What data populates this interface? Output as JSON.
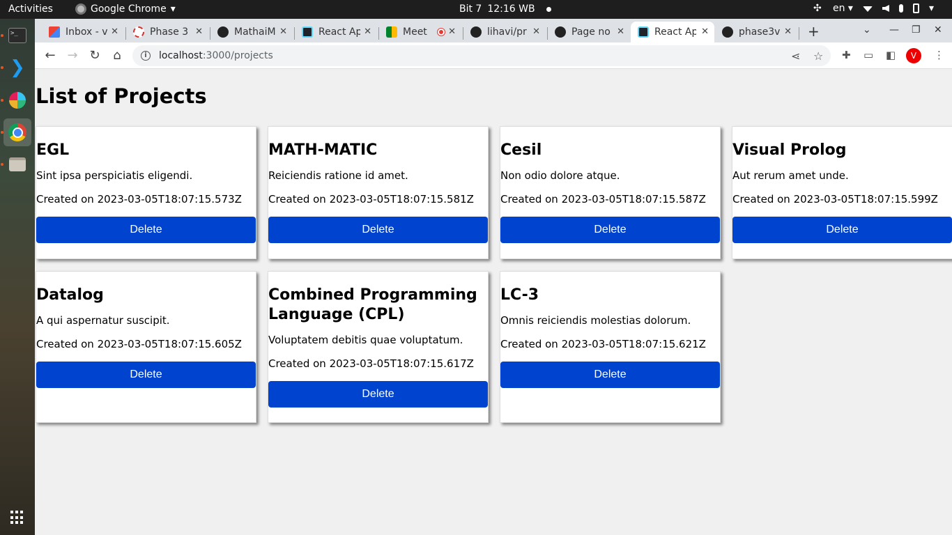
{
  "topbar": {
    "activities": "Activities",
    "app_name": "Google Chrome",
    "day": "Bit 7",
    "time": "12:16 WB",
    "lang": "en"
  },
  "dock": {
    "items": [
      "terminal",
      "vscode",
      "slack",
      "chrome",
      "files"
    ]
  },
  "tabs": [
    {
      "label": "Inbox - v",
      "icon": "gmail-icon"
    },
    {
      "label": "Phase 3",
      "icon": "phase-icon"
    },
    {
      "label": "MathaiM",
      "icon": "github-icon"
    },
    {
      "label": "React Ap",
      "icon": "react-icon"
    },
    {
      "label": "Meet",
      "icon": "meet-icon"
    },
    {
      "label": "lihavi/pr",
      "icon": "github-icon"
    },
    {
      "label": "Page no",
      "icon": "github-icon"
    },
    {
      "label": "React Ap",
      "icon": "react-icon",
      "active": true
    },
    {
      "label": "phase3v",
      "icon": "github-icon"
    }
  ],
  "address": {
    "host": "localhost",
    "path": ":3000/projects"
  },
  "profile_initial": "V",
  "page": {
    "title": "List of Projects",
    "created_prefix": "Created on ",
    "delete_label": "Delete",
    "projects": [
      {
        "name": "EGL",
        "description": "Sint ipsa perspiciatis eligendi.",
        "created_on": "Created on 2023-03-05T18:07:15.573Z"
      },
      {
        "name": "MATH-MATIC",
        "description": "Reiciendis ratione id amet.",
        "created_on": "Created on 2023-03-05T18:07:15.581Z"
      },
      {
        "name": "Cesil",
        "description": "Non odio dolore atque.",
        "created_on": "Created on 2023-03-05T18:07:15.587Z"
      },
      {
        "name": "Visual Prolog",
        "description": "Aut rerum amet unde.",
        "created_on": "Created on 2023-03-05T18:07:15.599Z"
      },
      {
        "name": "Datalog",
        "description": "A qui aspernatur suscipit.",
        "created_on": "Created on 2023-03-05T18:07:15.605Z"
      },
      {
        "name": "Combined Programming Language (CPL)",
        "description": "Voluptatem debitis quae voluptatum.",
        "created_on": "Created on 2023-03-05T18:07:15.617Z"
      },
      {
        "name": "LC-3",
        "description": "Omnis reiciendis molestias dolorum.",
        "created_on": "Created on 2023-03-05T18:07:15.621Z"
      }
    ]
  },
  "colors": {
    "delete_button": "#0043ce",
    "page_bg": "#f0f0f0"
  }
}
